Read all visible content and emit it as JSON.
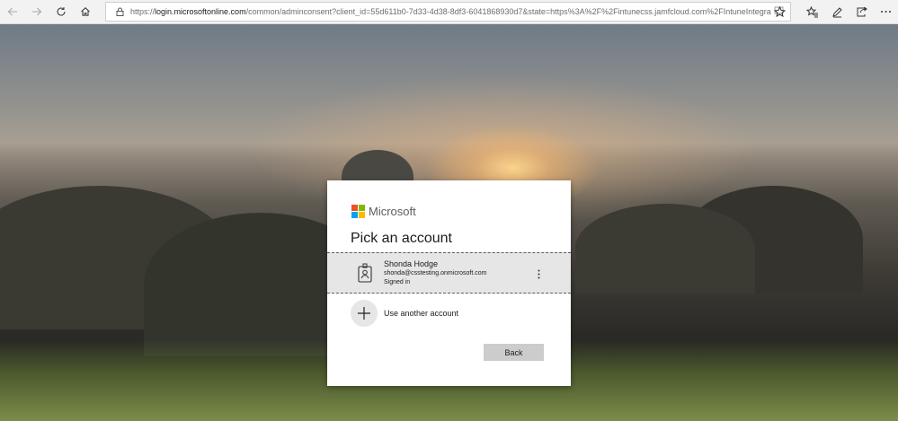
{
  "browser": {
    "url_prefix": "https://",
    "url_host": "login.microsoftonline.com",
    "url_rest": "/common/adminconsent?client_id=55d611b0-7d33-4d38-8df3-6041868930d7&state=https%3A%2F%2Fintunecss.jamfcloud.com%2FIntuneIntegration.html&redir",
    "icons": {
      "back": "arrow-left",
      "forward": "arrow-right",
      "refresh": "refresh",
      "home": "home",
      "lock": "lock",
      "reading_view": "book",
      "favorite": "star",
      "favorites_hub": "star-list",
      "notes": "pen",
      "share": "share",
      "menu": "ellipsis"
    }
  },
  "dialog": {
    "brand": "Microsoft",
    "brand_colors": [
      "#f25022",
      "#7fba00",
      "#00a4ef",
      "#ffb900"
    ],
    "title": "Pick an account",
    "account": {
      "name": "Shonda Hodge",
      "email": "shonda@csstesting.onmicrosoft.com",
      "status": "Signed in"
    },
    "other_account_label": "Use another account",
    "back_label": "Back"
  }
}
